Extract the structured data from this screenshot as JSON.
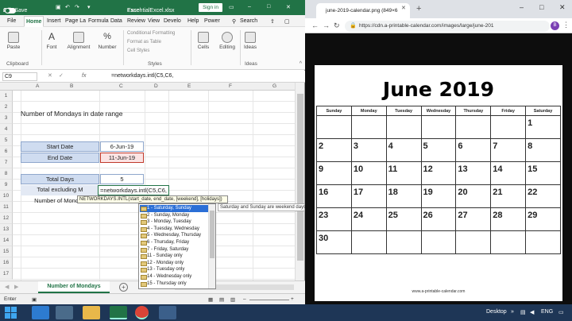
{
  "excel": {
    "autosave": "AutoSave",
    "autosave_state": "Off",
    "filename": "EssentialExcel.xlsx",
    "dash": "-",
    "app": "Excel",
    "signin": "Sign in",
    "tabs": [
      "File",
      "Home",
      "Insert",
      "Page La",
      "Formula",
      "Data",
      "Review",
      "View",
      "Develo",
      "Help",
      "Power",
      "Search"
    ],
    "ribbon": {
      "paste": "Paste",
      "clipboard": "Clipboard",
      "font": "Font",
      "alignment": "Alignment",
      "number": "Number",
      "cond_fmt": "Conditional Formatting",
      "fmt_table": "Format as Table",
      "cell_styles": "Cell Styles",
      "styles": "Styles",
      "cells": "Cells",
      "editing": "Editing",
      "ideas": "Ideas",
      "ideas_group": "Ideas"
    },
    "namebox": "C9",
    "fx": "fx",
    "formula": "=networkdays.intl(C5,C6,",
    "columns": [
      "A",
      "B",
      "C",
      "D",
      "E",
      "F",
      "G"
    ],
    "rows": [
      "1",
      "2",
      "3",
      "4",
      "5",
      "6",
      "7",
      "8",
      "9",
      "10",
      "11",
      "12",
      "13",
      "14",
      "15",
      "16",
      "17"
    ],
    "title": "Number of Mondays in date range",
    "start_label": "Start Date",
    "start_value": "6-Jun-19",
    "end_label": "End Date",
    "end_value": "11-Jun-19",
    "total_label": "Total Days",
    "total_value": "5",
    "excl_label": "Total excluding M",
    "excl_formula": "=networkdays.intl(C5,C6,",
    "mondays_label": "Number of Mond",
    "tooltip": "NETWORKDAYS.INTL(start_date, end_date, [weekend], [holidays])",
    "options": [
      "1 - Saturday, Sunday",
      "2 - Sunday, Monday",
      "3 - Monday, Tuesday",
      "4 - Tuesday, Wednesday",
      "5 - Wednesday, Thursday",
      "6 - Thursday, Friday",
      "7 - Friday, Saturday",
      "11 - Sunday only",
      "12 - Monday only",
      "13 - Tuesday only",
      "14 - Wednesday only",
      "15 - Thursday only"
    ],
    "option_desc": "Saturday and Sunday are weekend days",
    "sheet_tab": "Number of Mondays",
    "status": "Enter"
  },
  "browser": {
    "tab_title": "june-2019-calendar.png (849×6",
    "url": "https://cdn.a-printable-calendar.com/images/large/june-201",
    "profile": "B",
    "cal_title": "June 2019",
    "days": [
      "Sunday",
      "Monday",
      "Tuesday",
      "Wednesday",
      "Thursday",
      "Friday",
      "Saturday"
    ],
    "weeks": [
      [
        "",
        "",
        "",
        "",
        "",
        "",
        "1"
      ],
      [
        "2",
        "3",
        "4",
        "5",
        "6",
        "7",
        "8"
      ],
      [
        "9",
        "10",
        "11",
        "12",
        "13",
        "14",
        "15"
      ],
      [
        "16",
        "17",
        "18",
        "19",
        "20",
        "21",
        "22"
      ],
      [
        "23",
        "24",
        "25",
        "26",
        "27",
        "28",
        "29"
      ],
      [
        "30",
        "",
        "",
        "",
        "",
        "",
        ""
      ]
    ],
    "cal_url": "www.a-printable-calendar.com"
  },
  "taskbar": {
    "desktop": "Desktop",
    "lang": "ENG"
  },
  "colors": {
    "excel_green": "#217346",
    "taskbar": "#1e3656",
    "label_fill": "#cfdcf0"
  }
}
